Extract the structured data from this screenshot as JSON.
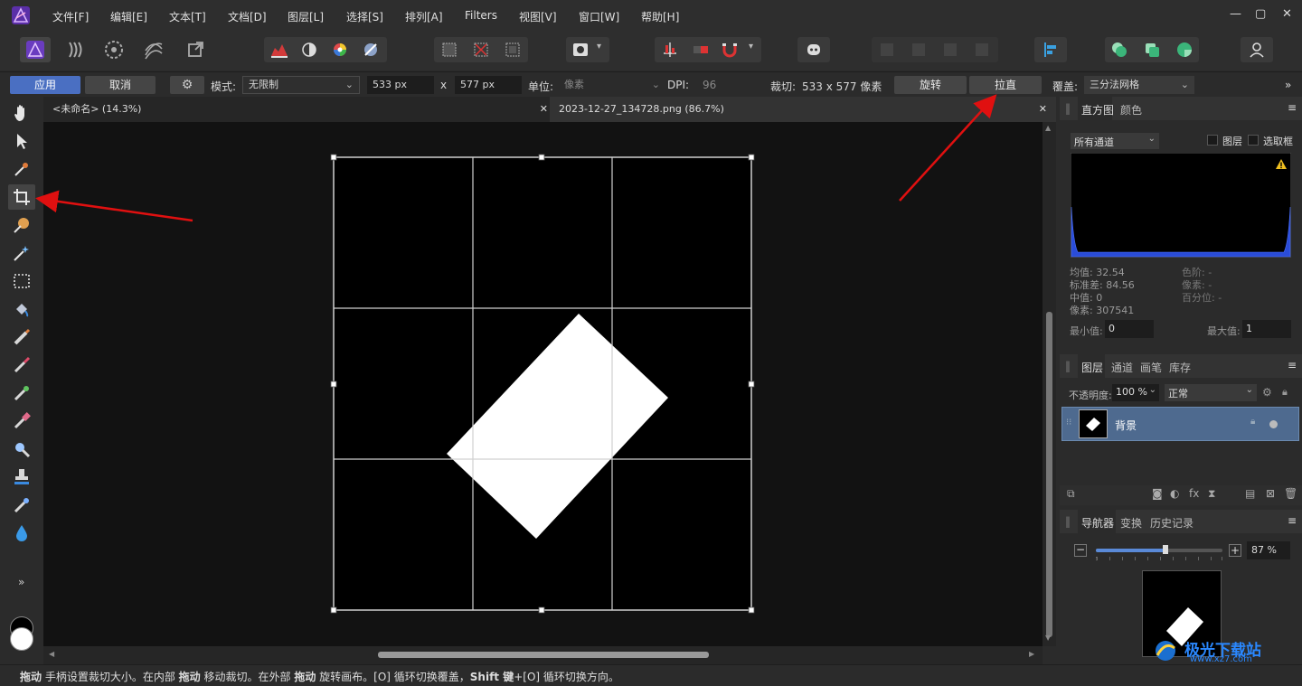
{
  "menubar": {
    "items": [
      "文件[F]",
      "编辑[E]",
      "文本[T]",
      "文档[D]",
      "图层[L]",
      "选择[S]",
      "排列[A]",
      "Filters",
      "视图[V]",
      "窗口[W]",
      "帮助[H]"
    ],
    "window_controls": [
      "—",
      "▢",
      "✕"
    ]
  },
  "context_bar": {
    "apply_label": "应用",
    "cancel_label": "取消",
    "mode_label": "模式:",
    "mode_value": "无限制",
    "width_value": "533 px",
    "x_label": "x",
    "height_value": "577 px",
    "unit_label": "单位:",
    "unit_value": "像素",
    "dpi_label": "DPI:",
    "dpi_value": "96",
    "crop_label": "裁切:",
    "crop_value": "533 x 577 像素",
    "rotate_label": "旋转",
    "straighten_label": "拉直",
    "overlay_label": "覆盖:",
    "overlay_value": "三分法网格",
    "more": "»"
  },
  "doc_tabs": [
    {
      "title": "<未命名> (14.3%)"
    },
    {
      "title": "2023-12-27_134728.png (86.7%)"
    }
  ],
  "tools_more": "»",
  "histogram_panel": {
    "tabs": [
      "直方图",
      "颜色"
    ],
    "channel_value": "所有通道",
    "layer_check": "图层",
    "marquee_check": "选取框",
    "stats_left": [
      "均值: 32.54",
      "标准差: 84.56",
      "中值: 0",
      "像素: 307541"
    ],
    "stats_right": [
      "色阶: -",
      "像素: -",
      "百分位: -"
    ],
    "min_label": "最小值:",
    "min_value": "0",
    "max_label": "最大值:",
    "max_value": "1"
  },
  "layers_panel": {
    "tabs": [
      "图层",
      "通道",
      "画笔",
      "库存"
    ],
    "opacity_label": "不透明度:",
    "opacity_value": "100 %",
    "blend_value": "正常",
    "layer_name": "背景"
  },
  "navigator_panel": {
    "tabs": [
      "导航器",
      "变换",
      "历史记录"
    ],
    "zoom_value": "87 %",
    "zoom_level": 0.55
  },
  "status": {
    "parts": [
      {
        "text": "拖动",
        "bold": true
      },
      {
        "text": " 手柄设置裁切大小。在内部 ",
        "bold": false
      },
      {
        "text": "拖动",
        "bold": true
      },
      {
        "text": " 移动裁切。在外部 ",
        "bold": false
      },
      {
        "text": "拖动",
        "bold": true
      },
      {
        "text": " 旋转画布。[O] 循环切换覆盖，",
        "bold": false
      },
      {
        "text": "Shift 键",
        "bold": true
      },
      {
        "text": "+[O] 循环切换方向。",
        "bold": false
      }
    ]
  },
  "watermark": {
    "title": "极光下载站",
    "url": "www.xz7.com"
  },
  "colors": {
    "accent": "#4a6fc2",
    "arrow": "#e01010",
    "selected_layer": "#4e6a8f"
  }
}
